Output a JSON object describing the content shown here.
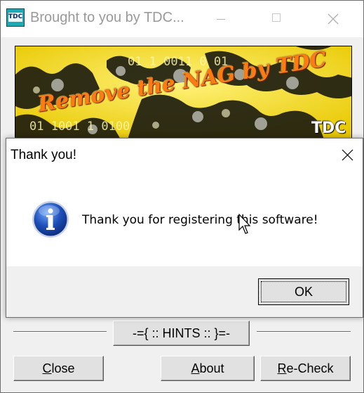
{
  "main_window": {
    "title": "Brought to you by TDC...",
    "app_icon_text": "TDC",
    "banner": {
      "title": "Remove the NAG by TDC",
      "logo": "TDC",
      "bits_top": "01 1 0011 0 01",
      "bits_bottom": "01 1001 1 0100"
    },
    "hints_label": "-={ :: HINTS :: }=-",
    "buttons": {
      "close": {
        "mnemonic": "C",
        "rest": "lose"
      },
      "about": {
        "mnemonic": "A",
        "rest": "bout"
      },
      "recheck": {
        "mnemonic": "R",
        "rest": "e-Check"
      }
    }
  },
  "dialog": {
    "title": "Thank you!",
    "message": "Thank you for registering this software!",
    "ok_label": "OK",
    "icon": "info-icon"
  },
  "colors": {
    "banner_yellow": "#f7e21a",
    "banner_text": "#ff7b12",
    "info_blue": "#1d4fb8"
  }
}
